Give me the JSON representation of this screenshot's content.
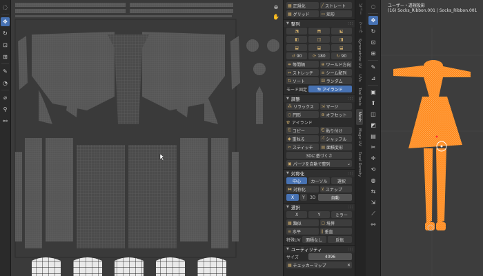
{
  "left_toolbar": {
    "tools": [
      {
        "icon": "cursor-icon",
        "glyph": "◌"
      },
      {
        "icon": "move-icon",
        "glyph": "✥",
        "active": true
      },
      {
        "icon": "rotate-icon",
        "glyph": "↻"
      },
      {
        "icon": "scale-icon",
        "glyph": "⊡"
      },
      {
        "icon": "transform-icon",
        "glyph": "⊞"
      },
      {
        "icon": "annotate-icon",
        "glyph": "✎"
      },
      {
        "icon": "grab-icon",
        "glyph": "◔"
      },
      {
        "icon": "relax-icon",
        "glyph": "⌀"
      },
      {
        "icon": "pinch-icon",
        "glyph": "⚲"
      },
      {
        "icon": "rip-icon",
        "glyph": "⚯"
      }
    ]
  },
  "uv_editor": {
    "nav_icons": [
      "zoom-icon",
      "hand-icon"
    ]
  },
  "panel": {
    "top_buttons": [
      [
        "正規化",
        "ストレート"
      ],
      [
        "グリッド",
        "矩形"
      ]
    ],
    "align": {
      "header": "整列",
      "angles": [
        "90",
        "180",
        "90"
      ],
      "buttons": [
        [
          "等間隔",
          "ワールド方向"
        ],
        [
          "ストレッチ",
          "シーム配列"
        ],
        [
          "ソート",
          "ランダム"
        ]
      ],
      "mode_label": "モード固定",
      "mode_value": "アイランド"
    },
    "adjust": {
      "header": "調整",
      "buttons": [
        [
          "リラックス",
          "マージ"
        ],
        [
          "円形",
          "オフセット"
        ]
      ],
      "island_label": "アイランド",
      "island_buttons": [
        [
          "コピー",
          "貼り付け"
        ],
        [
          "重ねる",
          "シャッフル"
        ],
        [
          "スティッチ",
          "面積変形"
        ]
      ],
      "orient_label": "3Dに基づくさ",
      "pack_label": "パーツを自動で整列"
    },
    "symmetry": {
      "header": "対称化",
      "tabs": [
        "中心",
        "カーソル",
        "選択"
      ],
      "buttons": [
        "対称化",
        "スナップ"
      ],
      "axis": "X",
      "mode_label": "3D",
      "mode_value": "自動"
    },
    "select": {
      "header": "選択",
      "buttons": [
        [
          "X",
          "Y",
          "ミラー"
        ],
        [
          "類似",
          "境界"
        ],
        [
          "水平",
          "垂直"
        ]
      ],
      "extra_label": "特殊UV",
      "extra_buttons": [
        "面積なし",
        "反転"
      ]
    },
    "utility": {
      "header": "ユーティリティ",
      "size_label": "サイズ",
      "size_value": "4096",
      "checker_label": "チェッカーマップ"
    }
  },
  "vertical_tabs": [
    "ビュー",
    "ツール",
    "Symmetrize UV",
    "UVs",
    "Tool Tools",
    "Mesh",
    "Magic UV",
    "Texel Density"
  ],
  "viewport": {
    "view_name": "ユーザー・透視投影",
    "object_info": "(16) Socks_Ribbon.001 | Socks_Ribbon.001",
    "mesh_color": "#ff8a1e",
    "tools": [
      "cursor-icon",
      "move-icon",
      "rotate-icon",
      "scale-icon",
      "transform-icon",
      "annotate-icon",
      "measure-icon",
      "add-cube-icon",
      "extrude-icon",
      "inset-icon",
      "bevel-icon",
      "loopcut-icon",
      "knife-icon",
      "polybuild-icon",
      "spin-icon",
      "smooth-icon",
      "edge-slide-icon",
      "shrink-icon",
      "shear-icon",
      "rip-icon"
    ]
  },
  "colors": {
    "accent": "#4772b3",
    "uv_background": "#3a3a3a",
    "panel_background": "#2b2b2b"
  }
}
